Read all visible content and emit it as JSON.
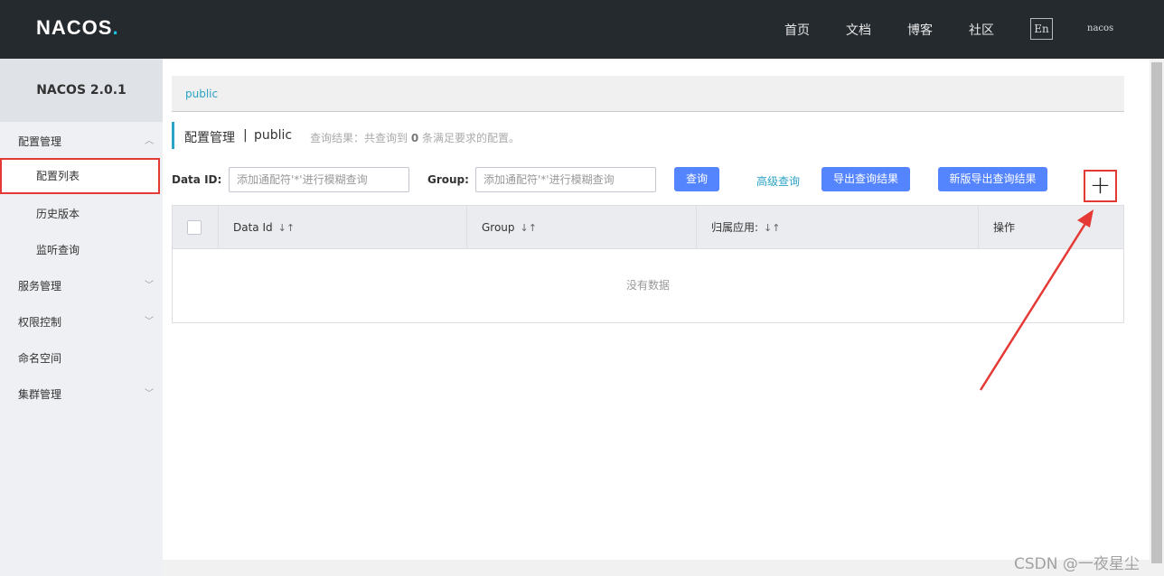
{
  "header": {
    "logo": "NACOS.",
    "logo_main": "NACOS",
    "logo_dot": ".",
    "nav": [
      "首页",
      "文档",
      "博客",
      "社区"
    ],
    "lang": "En",
    "user": "nacos"
  },
  "sidebar": {
    "version": "NACOS 2.0.1",
    "items": [
      {
        "label": "配置管理",
        "expanded": true
      },
      {
        "label": "配置列表",
        "active": true
      },
      {
        "label": "历史版本"
      },
      {
        "label": "监听查询"
      },
      {
        "label": "服务管理"
      },
      {
        "label": "权限控制"
      },
      {
        "label": "命名空间"
      },
      {
        "label": "集群管理"
      }
    ]
  },
  "main": {
    "namespace_tab": "public",
    "title": "配置管理",
    "title_sep": "|",
    "title_namespace": "public",
    "hint_prefix": "查询结果：共查询到",
    "hint_count": "0",
    "hint_suffix": "条满足要求的配置。",
    "filters": {
      "data_id_label": "Data ID:",
      "data_id_placeholder": "添加通配符'*'进行模糊查询",
      "group_label": "Group:",
      "group_placeholder": "添加通配符'*'进行模糊查询"
    },
    "buttons": {
      "query": "查询",
      "advanced": "高级查询",
      "export": "导出查询结果",
      "export_new": "新版导出查询结果",
      "add": "+"
    },
    "table": {
      "columns": [
        "Data Id",
        "Group",
        "归属应用:",
        "操作"
      ],
      "sort_icon": "↓↑",
      "empty_text": "没有数据"
    }
  },
  "watermark": "CSDN @一夜星尘",
  "colors": {
    "topbar": "#252a2f",
    "accent": "#2aa3c4",
    "primary_button": "#5584ff",
    "highlight_border": "#e53935"
  }
}
